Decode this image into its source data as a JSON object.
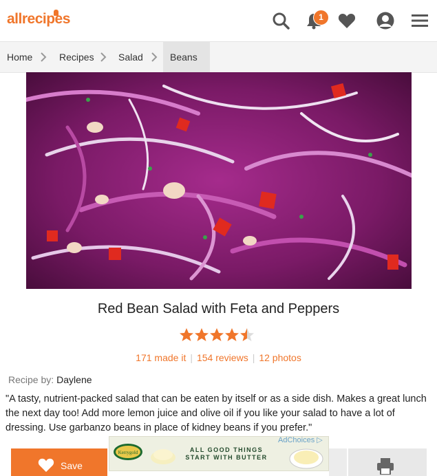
{
  "header": {
    "logo": "allrecipes",
    "notification_count": "1",
    "icons": [
      "search-icon",
      "bell-icon",
      "heart-icon",
      "user-icon",
      "hamburger-menu-icon"
    ],
    "accent_color": "#f0762b"
  },
  "breadcrumb": [
    "Home",
    "Recipes",
    "Salad",
    "Beans"
  ],
  "recipe": {
    "title": "Red Bean Salad with Feta and Peppers",
    "rating": 4.5,
    "made_it": "171 made it",
    "reviews": "154 reviews",
    "photos": "12 photos",
    "byline_label": "Recipe by:",
    "author": "Daylene",
    "description": "\"A tasty, nutrient-packed salad that can be eaten by itself or as a side dish. Makes a great lunch the next day too! Add more lemon juice and olive oil if you like your salad to have a lot of dressing. Use garbanzo beans in place of kidney beans if you prefer.\""
  },
  "actions": {
    "save_label": "Save"
  },
  "ad": {
    "line1": "ALL GOOD THINGS",
    "line2": "START WITH BUTTER",
    "brand": "Kerrygold",
    "adchoices": "AdChoices"
  }
}
